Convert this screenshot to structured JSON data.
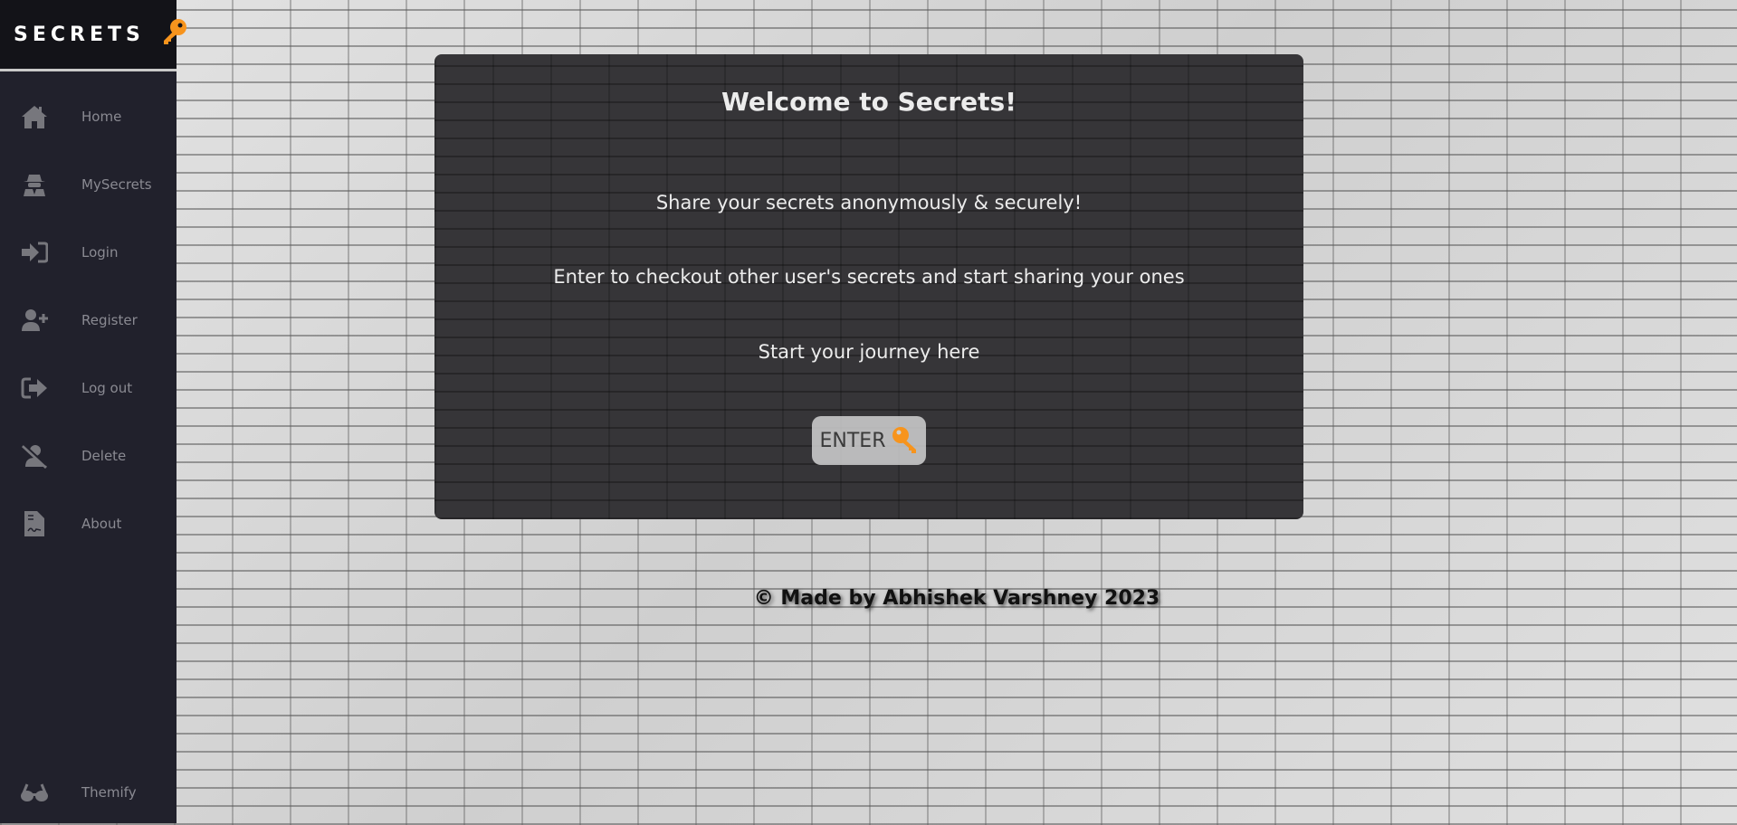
{
  "brand": {
    "name": "SECRETS",
    "icon": "key-icon",
    "accent": "#f7941d"
  },
  "sidebar": {
    "items": [
      {
        "label": "Home",
        "icon": "home-icon"
      },
      {
        "label": "MySecrets",
        "icon": "user-secret-icon"
      },
      {
        "label": "Login",
        "icon": "sign-in-icon"
      },
      {
        "label": "Register",
        "icon": "user-plus-icon"
      },
      {
        "label": "Log out",
        "icon": "sign-out-icon"
      },
      {
        "label": "Delete",
        "icon": "user-slash-icon"
      },
      {
        "label": "About",
        "icon": "file-contract-icon"
      },
      {
        "label": "Themify",
        "icon": "glasses-icon"
      }
    ]
  },
  "card": {
    "title": "Welcome to Secrets!",
    "lines": [
      "Share your secrets anonymously & securely!",
      "Enter to checkout other user's secrets and start sharing your ones",
      "Start your journey here"
    ],
    "enter_label": "ENTER"
  },
  "footer": {
    "text": "© Made by Abhishek Varshney 2023"
  }
}
